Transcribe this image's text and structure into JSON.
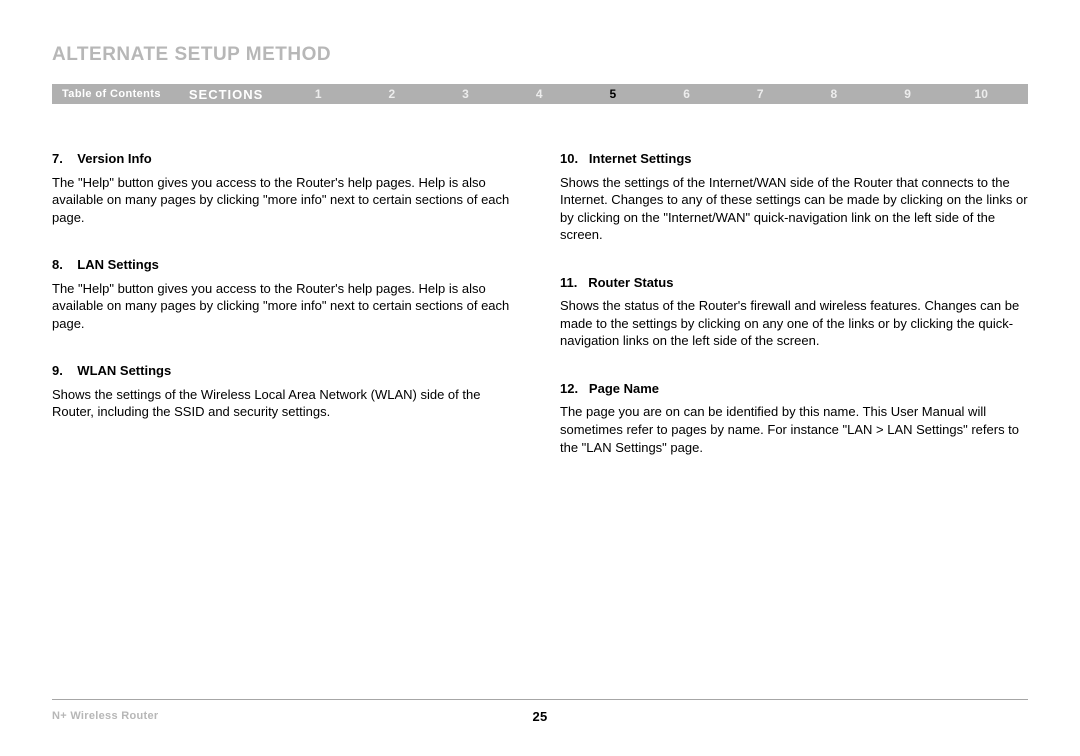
{
  "header": {
    "title": "ALTERNATE SETUP METHOD"
  },
  "navbar": {
    "toc": "Table of Contents",
    "sections_label": "SECTIONS",
    "numbers": [
      "1",
      "2",
      "3",
      "4",
      "5",
      "6",
      "7",
      "8",
      "9",
      "10"
    ],
    "current": "5"
  },
  "left_column": [
    {
      "num": "7.",
      "title": "Version Info",
      "body": "The \"Help\" button gives you access to the Router's help pages. Help is also available on many pages by clicking \"more info\" next to certain sections of each page."
    },
    {
      "num": "8.",
      "title": "LAN Settings",
      "body": "The \"Help\" button gives you access to the Router's help pages. Help is also available on many pages by clicking \"more info\" next to certain sections of each page."
    },
    {
      "num": "9.",
      "title": "WLAN Settings",
      "body": "Shows the settings of the Wireless Local Area Network (WLAN) side of the Router, including the SSID and security settings."
    }
  ],
  "right_column": [
    {
      "num": "10.",
      "title": "Internet Settings",
      "body": "Shows the settings of the Internet/WAN side of the Router that connects to the Internet. Changes to any of these settings can be made by clicking on the links or by clicking on the \"Internet/WAN\" quick-navigation link on the left side of the screen."
    },
    {
      "num": "11.",
      "title": "Router Status",
      "body": "Shows the status of the Router's firewall and wireless features. Changes can be made to the settings by clicking on any one of the links or by clicking the quick-navigation links on the left side of the screen."
    },
    {
      "num": "12.",
      "title": "Page Name",
      "body": "The page you are on can be identified by this name. This User Manual will sometimes refer to pages by name. For instance \"LAN > LAN Settings\" refers to the \"LAN Settings\" page."
    }
  ],
  "footer": {
    "product": "N+ Wireless Router",
    "page_number": "25"
  }
}
